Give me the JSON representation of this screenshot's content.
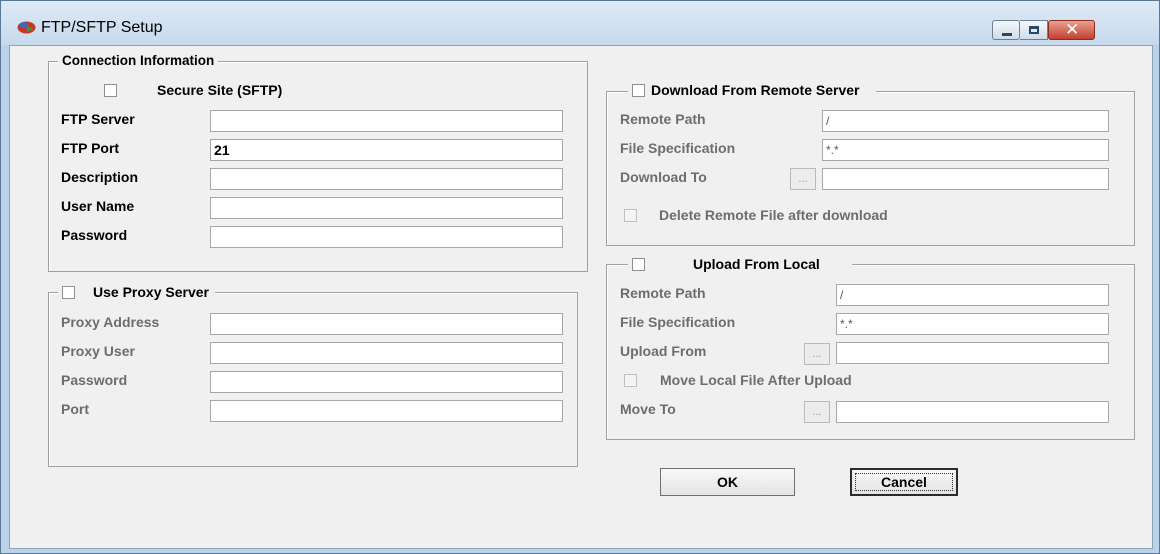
{
  "window": {
    "title": "FTP/SFTP  Setup",
    "icon": "ftp-app-icon",
    "controls": {
      "minimize": "minimize-icon",
      "maximize": "maximize-icon",
      "close": "✕"
    }
  },
  "connection": {
    "legend": "Connection Information",
    "secure_site_label": "Secure Site (SFTP)",
    "secure_site_checked": false,
    "fields": [
      {
        "label": "FTP Server",
        "value": ""
      },
      {
        "label": "FTP Port",
        "value": "21"
      },
      {
        "label": "Description",
        "value": ""
      },
      {
        "label": "User Name",
        "value": ""
      },
      {
        "label": "Password",
        "value": ""
      }
    ]
  },
  "proxy": {
    "legend": "Use Proxy Server",
    "enabled": false,
    "fields": [
      {
        "label": "Proxy Address",
        "value": ""
      },
      {
        "label": "Proxy User",
        "value": ""
      },
      {
        "label": "Password",
        "value": ""
      },
      {
        "label": "Port",
        "value": ""
      }
    ]
  },
  "download": {
    "legend": "Download From Remote Server",
    "enabled": false,
    "remote_path_label": "Remote Path",
    "remote_path_value": "/",
    "file_spec_label": "File Specification",
    "file_spec_value": "*.*",
    "download_to_label": "Download To",
    "download_to_value": "",
    "browse_label": "...",
    "delete_label": "Delete Remote File after download",
    "delete_checked": false
  },
  "upload": {
    "legend": "Upload From Local",
    "enabled": false,
    "remote_path_label": "Remote Path",
    "remote_path_value": "/",
    "file_spec_label": "File Specification",
    "file_spec_value": "*.*",
    "upload_from_label": "Upload From",
    "upload_from_value": "",
    "browse_label": "...",
    "move_label": "Move Local File After Upload",
    "move_checked": false,
    "move_to_label": "Move To",
    "move_to_value": ""
  },
  "buttons": {
    "ok": "OK",
    "cancel": "Cancel"
  },
  "colors": {
    "disabled_text": "#6d6d6d",
    "dialog_bg": "#f0f0f0",
    "title_bar": "#c6d9ec",
    "close_button": "#c3412d"
  }
}
